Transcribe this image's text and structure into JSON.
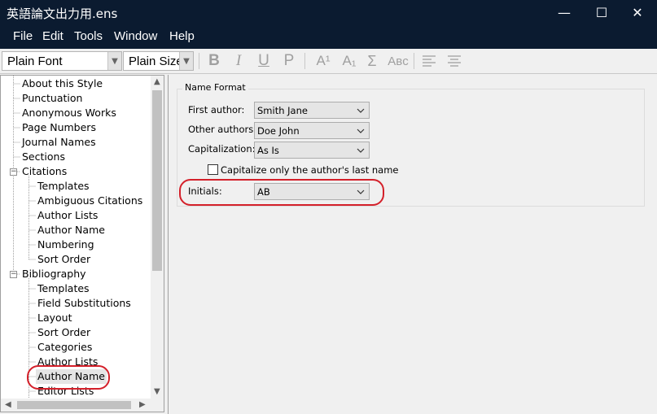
{
  "window": {
    "title": "英語論文出力用.ens",
    "controls": {
      "minimize": "—",
      "maximize": "☐",
      "close": "✕"
    }
  },
  "menu": [
    "File",
    "Edit",
    "Tools",
    "Window",
    "Help"
  ],
  "toolbar": {
    "font": "Plain Font",
    "size": "Plain Size",
    "buttons": {
      "bold": "B",
      "italic": "I",
      "underline": "U",
      "plain": "P",
      "superscript": "A¹",
      "subscript": "A₁",
      "symbol": "Σ",
      "small_caps": "Aʙᴄ"
    }
  },
  "tree": {
    "items": [
      {
        "label": "About this Style"
      },
      {
        "label": "Punctuation"
      },
      {
        "label": "Anonymous Works"
      },
      {
        "label": "Page Numbers"
      },
      {
        "label": "Journal Names"
      },
      {
        "label": "Sections"
      },
      {
        "label": "Citations",
        "toggle": "−"
      },
      {
        "label": "Templates"
      },
      {
        "label": "Ambiguous Citations"
      },
      {
        "label": "Author Lists"
      },
      {
        "label": "Author Name"
      },
      {
        "label": "Numbering"
      },
      {
        "label": "Sort Order"
      },
      {
        "label": "Bibliography",
        "toggle": "−"
      },
      {
        "label": "Templates"
      },
      {
        "label": "Field Substitutions"
      },
      {
        "label": "Layout"
      },
      {
        "label": "Sort Order"
      },
      {
        "label": "Categories"
      },
      {
        "label": "Author Lists"
      },
      {
        "label": "Author Name"
      },
      {
        "label": "Editor Lists"
      }
    ]
  },
  "name_format": {
    "group_title": "Name Format",
    "first_author_label": "First author:",
    "first_author_value": "Smith Jane",
    "other_authors_label": "Other authors:",
    "other_authors_value": "Doe John",
    "capitalization_label": "Capitalization:",
    "capitalization_value": "As Is",
    "capitalize_last_label": "Capitalize only the author's last name",
    "initials_label": "Initials:",
    "initials_value": "AB"
  },
  "colors": {
    "titlebar": "#0b1b30",
    "highlight": "#d4202a"
  }
}
